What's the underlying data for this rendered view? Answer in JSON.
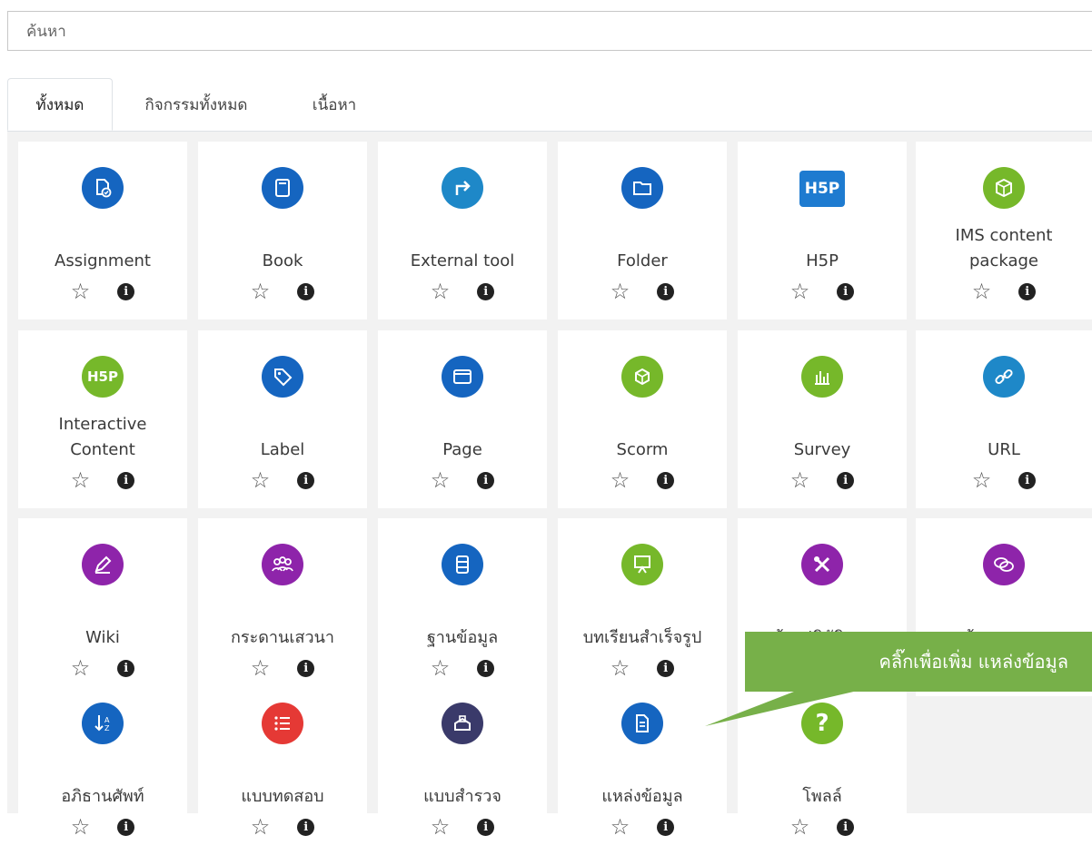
{
  "search": {
    "placeholder": "ค้นหา"
  },
  "tabs": [
    {
      "label": "ทั้งหมด",
      "active": true
    },
    {
      "label": "กิจกรรมทั้งหมด",
      "active": false
    },
    {
      "label": "เนื้อหา",
      "active": false
    }
  ],
  "modules": [
    {
      "label": "Assignment",
      "icon": "assignment-icon",
      "color": "#1565c0"
    },
    {
      "label": "Book",
      "icon": "book-icon",
      "color": "#1565c0"
    },
    {
      "label": "External tool",
      "icon": "external-tool-icon",
      "color": "#1e88c8"
    },
    {
      "label": "Folder",
      "icon": "folder-icon",
      "color": "#1565c0"
    },
    {
      "label": "H5P",
      "icon": "h5p-icon",
      "color": "#1e7bd0"
    },
    {
      "label": "IMS content package",
      "icon": "ims-package-icon",
      "color": "#76b82a"
    },
    {
      "label": "Interactive Content",
      "icon": "h5p-interactive-icon",
      "color": "#76b82a"
    },
    {
      "label": "Label",
      "icon": "label-icon",
      "color": "#1565c0"
    },
    {
      "label": "Page",
      "icon": "page-icon",
      "color": "#1565c0"
    },
    {
      "label": "Scorm",
      "icon": "scorm-icon",
      "color": "#76b82a"
    },
    {
      "label": "Survey",
      "icon": "survey-icon",
      "color": "#76b82a"
    },
    {
      "label": "URL",
      "icon": "url-icon",
      "color": "#1e88c8"
    },
    {
      "label": "Wiki",
      "icon": "wiki-icon",
      "color": "#8e24aa"
    },
    {
      "label": "กระดานเสวนา",
      "icon": "forum-icon",
      "color": "#8e24aa"
    },
    {
      "label": "ฐานข้อมูล",
      "icon": "database-icon",
      "color": "#1565c0"
    },
    {
      "label": "บทเรียนสำเร็จรูป",
      "icon": "lesson-icon",
      "color": "#76b82a"
    },
    {
      "label": "ห้องปฏิบัติการ",
      "icon": "workshop-icon",
      "color": "#8e24aa"
    },
    {
      "label": "ห้องสนทนา",
      "icon": "chat-icon",
      "color": "#8e24aa"
    },
    {
      "label": "อภิธานศัพท์",
      "icon": "glossary-icon",
      "color": "#1565c0"
    },
    {
      "label": "แบบทดสอบ",
      "icon": "quiz-icon",
      "color": "#e53935"
    },
    {
      "label": "แบบสำรวจ",
      "icon": "feedback-icon",
      "color": "#3a3a6a"
    },
    {
      "label": "แหล่งข้อมูล",
      "icon": "resource-icon",
      "color": "#1565c0"
    },
    {
      "label": "โพลล์",
      "icon": "choice-icon",
      "color": "#76b82a"
    }
  ],
  "callout": {
    "text": "คลิ๊กเพื่อเพิ่ม แหล่งข้อมูล",
    "color": "#77b049"
  }
}
